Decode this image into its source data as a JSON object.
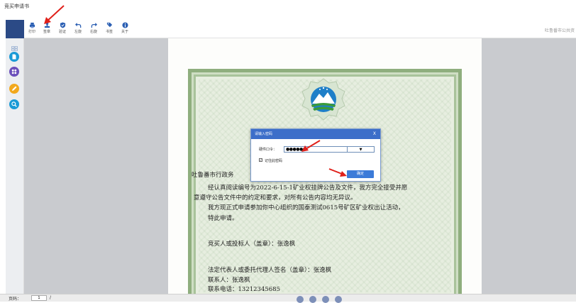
{
  "page": {
    "title": "竞买申请书"
  },
  "toolbar": {
    "buttons": [
      {
        "label": "打印",
        "icon": "printer-icon"
      },
      {
        "label": "签章",
        "icon": "stamp-icon"
      },
      {
        "label": "验证",
        "icon": "shield-check-icon"
      },
      {
        "label": "左旋",
        "icon": "rotate-left-icon"
      },
      {
        "label": "右旋",
        "icon": "rotate-right-icon"
      },
      {
        "label": "书签",
        "icon": "bookmark-tag-icon"
      },
      {
        "label": "关于",
        "icon": "info-icon"
      }
    ],
    "right_text": "吐鲁番市公共资"
  },
  "sidebar": {
    "icons": [
      "thumbnails-icon",
      "page-icon",
      "grid-icon",
      "pen-icon",
      "search-icon"
    ],
    "colors": [
      "#1a9ad6",
      "#6b4fbb",
      "#f2a81d",
      "#1a9ad6"
    ]
  },
  "document": {
    "lines": [
      "吐鲁番市行政务",
      "经认真阅读编号为2022-6-15-1矿业权挂牌公告及文件，我方完全接受并愿",
      "意遵守公告文件中的约定和要求，对所有公告内容均无异议。",
      "我方现正式申请参加你中心组织的国泰测试0615号矿区矿业权出让活动，",
      "特此申请。",
      "竞买人或投标人（盖章）：张逸枫",
      "法定代表人或委托代理人签名（盖章）：张逸枫",
      "联系人：张逸枫",
      "联系电话：13212345685"
    ]
  },
  "dialog": {
    "title": "请输入密码",
    "close": "X",
    "password_label": "硬件口令：",
    "password_value": "●●●●●●",
    "dropdown_arrow": "▼",
    "remember_label": "记住此密码",
    "remember_check": "✓",
    "ok_label": "确定"
  },
  "bottom": {
    "page_label": "页码：",
    "page_value": "1",
    "page_sep": "/"
  },
  "colors": {
    "toolbar_icon": "#2b5fb3",
    "dialog_header": "#3c6ec9",
    "viewer_bg": "#c9cbcf",
    "annotation_arrow": "#e0201a"
  }
}
